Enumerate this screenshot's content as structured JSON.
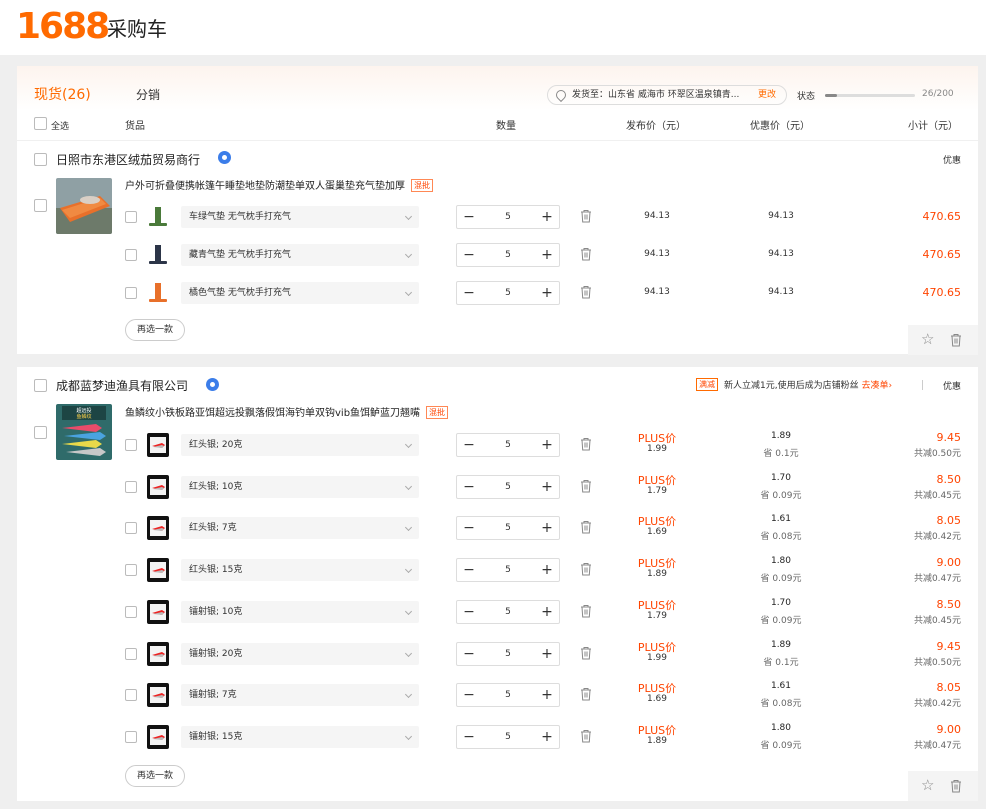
{
  "header": {
    "logo": "1688",
    "title": "采购车"
  },
  "tabs": {
    "active": "现货(26)",
    "other": "分销"
  },
  "address": {
    "text": "发货至：山东省 威海市 环翠区温泉镇青...",
    "change": "更改"
  },
  "status": {
    "label": "状态",
    "count": "26/200",
    "progress": 0.13
  },
  "columns": {
    "select_all": "全选",
    "goods": "货品",
    "quantity": "数量",
    "list_price": "发布价（元）",
    "sale_price": "优惠价（元）",
    "subtotal": "小计（元）"
  },
  "shops": [
    {
      "name": "日照市东港区绒茄贸易商行",
      "right_label": "优惠",
      "product_title": "户外可折叠便携帐篷午睡垫地垫防潮垫单双人蛋巢垫充气垫加厚",
      "mix_tag": "混批",
      "reselect": "再选一款",
      "skus": [
        {
          "spec": "车绿气垫 无气枕手打充气",
          "qty": "5",
          "list_price": "94.13",
          "sale_price": "94.13",
          "subtotal": "470.65",
          "color": "#4a7a3a"
        },
        {
          "spec": "藏青气垫 无气枕手打充气",
          "qty": "5",
          "list_price": "94.13",
          "sale_price": "94.13",
          "subtotal": "470.65",
          "color": "#2c3548"
        },
        {
          "spec": "橘色气垫 无气枕手打充气",
          "qty": "5",
          "list_price": "94.13",
          "sale_price": "94.13",
          "subtotal": "470.65",
          "color": "#e8702a"
        }
      ]
    },
    {
      "name": "成都蓝梦迪渔具有限公司",
      "promo_tag": "满减",
      "promo_text": "新人立减1元,使用后成为店铺粉丝",
      "promo_link": "去凑单›",
      "right_label": "优惠",
      "product_title": "鱼鳞纹小铁板路亚饵超远投飘落假饵海钓单双钩vib鱼饵鲈蓝刀翘嘴",
      "mix_tag": "混批",
      "reselect": "再选一款",
      "skus": [
        {
          "spec": "红头银; 20克",
          "qty": "5",
          "plus_label": "PLUS价",
          "plus_price": "1.99",
          "sale_price": "1.89",
          "save": "省 0.1元",
          "subtotal": "9.45",
          "reduce": "共减0.50元"
        },
        {
          "spec": "红头银; 10克",
          "qty": "5",
          "plus_label": "PLUS价",
          "plus_price": "1.79",
          "sale_price": "1.70",
          "save": "省 0.09元",
          "subtotal": "8.50",
          "reduce": "共减0.45元"
        },
        {
          "spec": "红头银; 7克",
          "qty": "5",
          "plus_label": "PLUS价",
          "plus_price": "1.69",
          "sale_price": "1.61",
          "save": "省 0.08元",
          "subtotal": "8.05",
          "reduce": "共减0.42元"
        },
        {
          "spec": "红头银; 15克",
          "qty": "5",
          "plus_label": "PLUS价",
          "plus_price": "1.89",
          "sale_price": "1.80",
          "save": "省 0.09元",
          "subtotal": "9.00",
          "reduce": "共减0.47元"
        },
        {
          "spec": "镭射银; 10克",
          "qty": "5",
          "plus_label": "PLUS价",
          "plus_price": "1.79",
          "sale_price": "1.70",
          "save": "省 0.09元",
          "subtotal": "8.50",
          "reduce": "共减0.45元"
        },
        {
          "spec": "镭射银; 20克",
          "qty": "5",
          "plus_label": "PLUS价",
          "plus_price": "1.99",
          "sale_price": "1.89",
          "save": "省 0.1元",
          "subtotal": "9.45",
          "reduce": "共减0.50元"
        },
        {
          "spec": "镭射银; 7克",
          "qty": "5",
          "plus_label": "PLUS价",
          "plus_price": "1.69",
          "sale_price": "1.61",
          "save": "省 0.08元",
          "subtotal": "8.05",
          "reduce": "共减0.42元"
        },
        {
          "spec": "镭射银; 15克",
          "qty": "5",
          "plus_label": "PLUS价",
          "plus_price": "1.89",
          "sale_price": "1.80",
          "save": "省 0.09元",
          "subtotal": "9.00",
          "reduce": "共减0.47元"
        }
      ]
    }
  ],
  "theme": {
    "accent": "#ff6a00",
    "price_red": "#ff4400"
  }
}
